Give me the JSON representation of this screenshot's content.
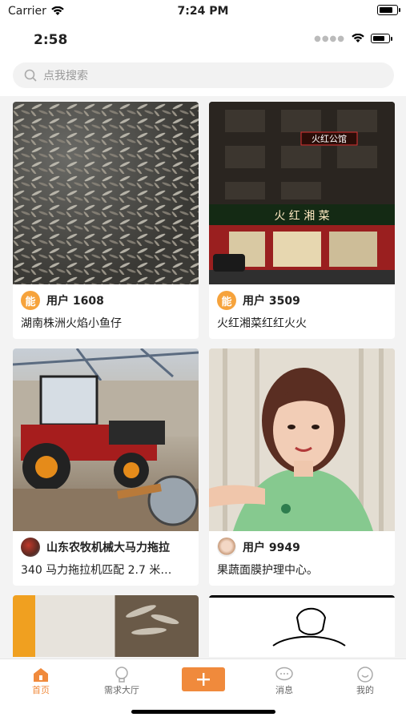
{
  "sim_status": {
    "carrier": "Carrier",
    "time": "7:24 PM"
  },
  "device_status": {
    "time": "2:58"
  },
  "search": {
    "placeholder": "点我搜索"
  },
  "feed": [
    {
      "user": "用户 1608",
      "avatar_text": "能",
      "desc": "湖南株洲火焰小鱼仔",
      "image": "dried-small-fish"
    },
    {
      "user": "用户 3509",
      "avatar_text": "能",
      "desc": "火红湘菜红红火火",
      "image": "restaurant-storefront",
      "sign_text": "火红公馆",
      "banner_text": "火 红 湘 菜"
    },
    {
      "user": "山东农牧机械大马力拖拉",
      "desc": "340 马力拖拉机匹配 2.7 米…",
      "image": "tractor-workshop"
    },
    {
      "user": "用户 9949",
      "desc": "果蔬面膜护理中心。",
      "image": "woman-portrait"
    },
    {
      "image": "partial-item-5"
    },
    {
      "image": "partial-item-6"
    }
  ],
  "tabs": [
    {
      "label": "首页",
      "icon": "home-icon"
    },
    {
      "label": "需求大厅",
      "icon": "bulb-icon"
    },
    {
      "label": "",
      "icon": "add-icon"
    },
    {
      "label": "消息",
      "icon": "message-icon"
    },
    {
      "label": "我的",
      "icon": "profile-icon"
    }
  ],
  "colors": {
    "accent": "#f08a3c",
    "avatar_orange": "#f6a33c"
  }
}
